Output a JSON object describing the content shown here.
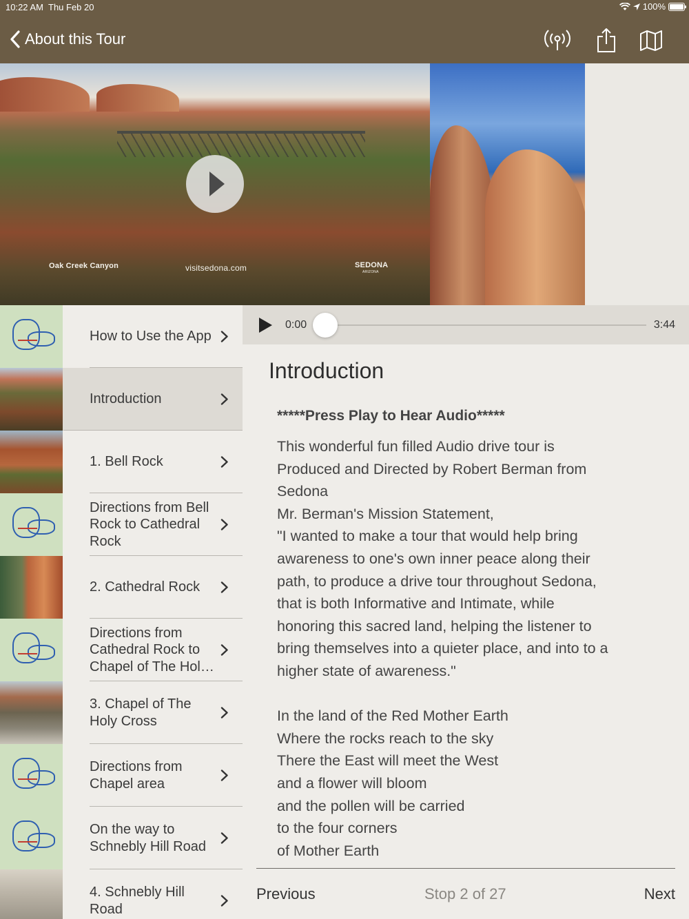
{
  "status": {
    "time": "10:22 AM",
    "date": "Thu Feb 20",
    "battery": "100%",
    "battery_level": 1.0
  },
  "nav": {
    "back_label": "About this Tour",
    "icons": [
      "broadcast-icon",
      "share-icon",
      "map-icon"
    ]
  },
  "hero": {
    "captions": {
      "left": "Oak Creek Canyon",
      "center": "visitsedona.com",
      "brand": "SEDONA",
      "brand_sub": "ARIZONA"
    }
  },
  "sidebar": {
    "items": [
      {
        "label": "How to Use the App",
        "thumb": "map",
        "selected": false
      },
      {
        "label": "Introduction",
        "thumb": "canyon",
        "selected": true
      },
      {
        "label": "1. Bell Rock",
        "thumb": "bell",
        "selected": false
      },
      {
        "label": "Directions from Bell Rock to Cathedral Rock",
        "thumb": "map",
        "selected": false
      },
      {
        "label": "2. Cathedral Rock",
        "thumb": "cathedral",
        "selected": false
      },
      {
        "label": "Directions from Cathedral Rock to Chapel of The Holy Cross",
        "thumb": "map",
        "selected": false
      },
      {
        "label": "3. Chapel of The Holy Cross",
        "thumb": "chapel",
        "selected": false
      },
      {
        "label": "Directions from Chapel area",
        "thumb": "map",
        "selected": false
      },
      {
        "label": "On the way to Schnebly Hill Road",
        "thumb": "map",
        "selected": false
      },
      {
        "label": "4. Schnebly Hill Road",
        "thumb": "wagon",
        "selected": false
      }
    ]
  },
  "audio": {
    "current": "0:00",
    "total": "3:44",
    "progress": 0
  },
  "content": {
    "title": "Introduction",
    "subtitle": "*****Press Play to Hear Audio*****",
    "lines": [
      "This wonderful fun filled Audio drive tour is",
      "Produced and Directed by Robert Berman from",
      "Sedona",
      "Mr. Berman's Mission Statement,",
      "\"I wanted to make a tour that would help bring",
      "awareness to one's own inner peace along their",
      "path, to produce a drive tour throughout Sedona,",
      "that is both Informative and Intimate, while",
      "honoring this sacred land, helping the listener to",
      "bring themselves into a quieter place, and into to a",
      "higher state of awareness.\"",
      "",
      "In the land of the Red Mother Earth",
      "Where the rocks reach to the sky",
      "There the East will meet the West",
      "and a flower will bloom",
      "and the pollen will be carried",
      "to the four corners",
      "of Mother Earth"
    ]
  },
  "footer": {
    "previous": "Previous",
    "stop": "Stop 2 of 27",
    "next": "Next"
  },
  "colors": {
    "header_bg": "#6b5c45",
    "page_bg": "#efede9",
    "selected_row": "#dddad4",
    "audio_bar": "#dedbd5"
  }
}
